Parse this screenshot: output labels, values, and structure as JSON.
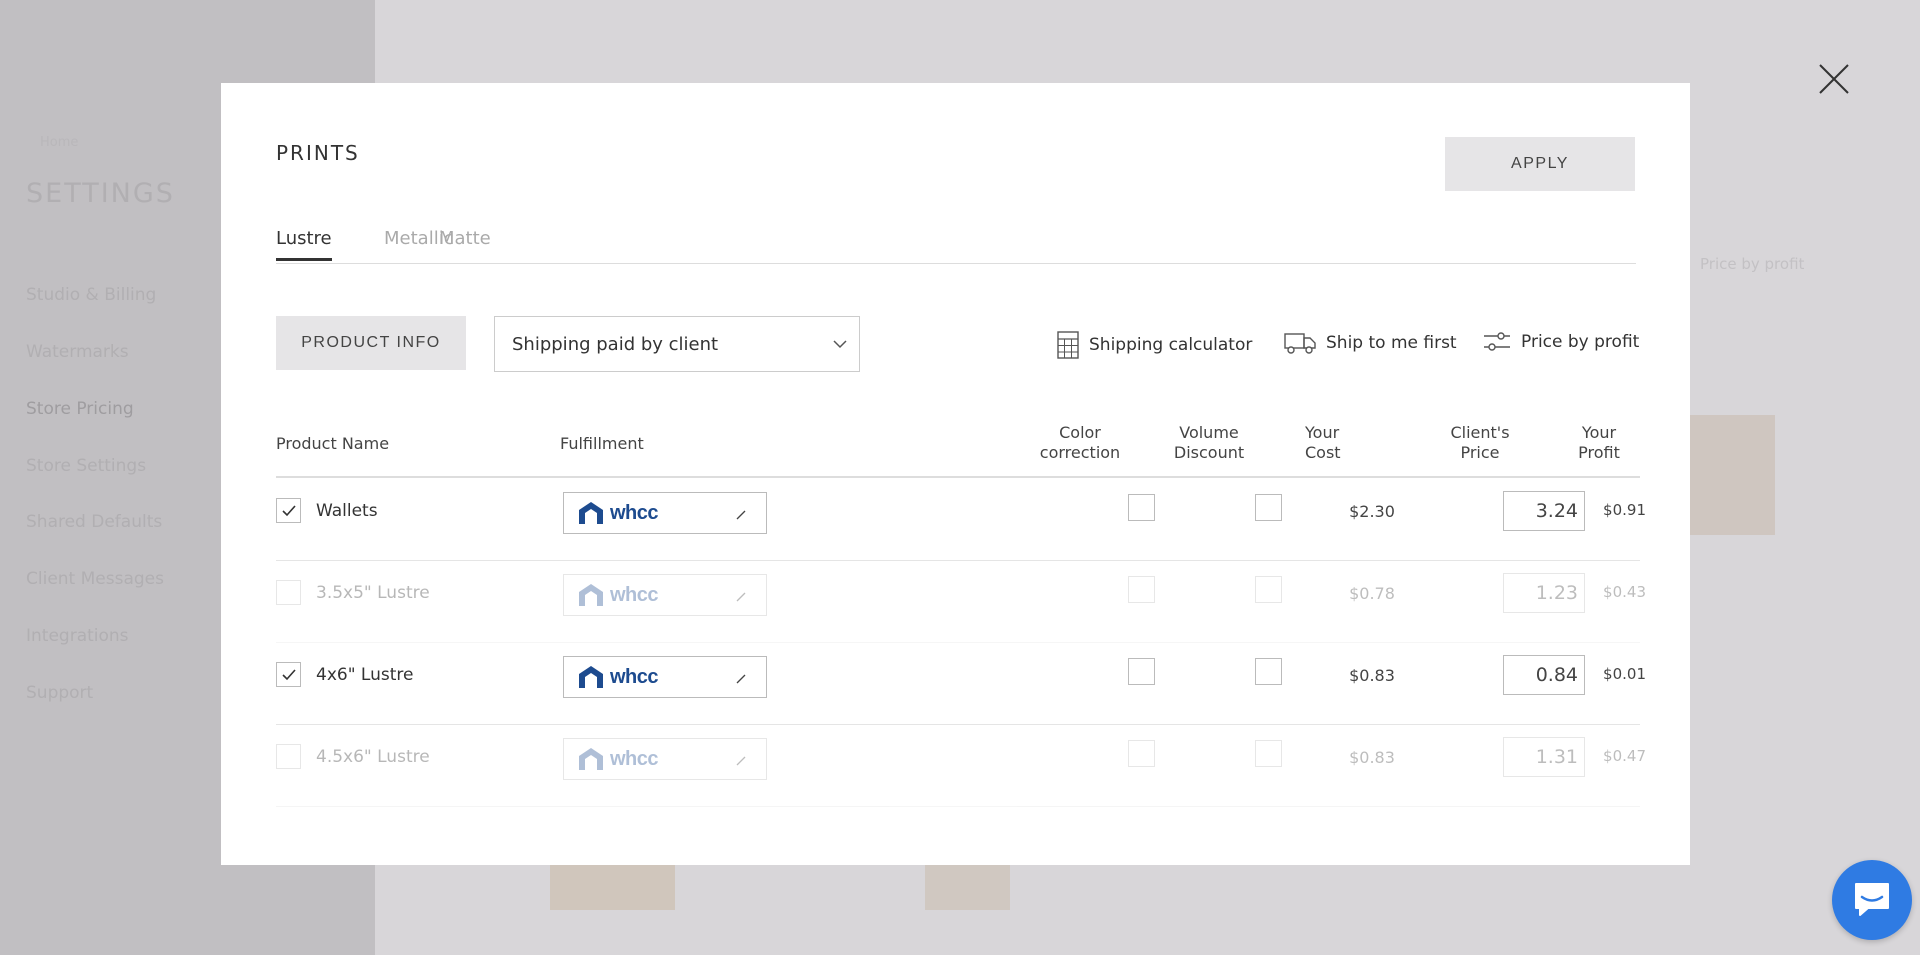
{
  "background": {
    "home": "Home",
    "settings_title": "SETTINGS",
    "nav": [
      "Studio & Billing",
      "Watermarks",
      "Store Pricing",
      "Store Settings",
      "Shared Defaults",
      "Client Messages",
      "Integrations",
      "Support"
    ],
    "active_nav": "Store Pricing",
    "price_by_profit": "Price by profit"
  },
  "modal": {
    "title": "PRINTS",
    "apply_label": "APPLY",
    "tabs": [
      {
        "label": "Lustre",
        "active": true
      },
      {
        "label": "Metallic",
        "active": false
      },
      {
        "label": "Matte",
        "active": false
      }
    ],
    "product_info_label": "PRODUCT INFO",
    "shipping_select": {
      "value": "Shipping paid by client"
    },
    "tools": {
      "shipping_calculator": "Shipping calculator",
      "ship_to_me_first": "Ship to me first",
      "price_by_profit": "Price by profit"
    },
    "table": {
      "headers": {
        "product_name": "Product Name",
        "fulfillment": "Fulfillment",
        "color_correction": [
          "Color",
          "correction"
        ],
        "volume_discount": [
          "Volume",
          "Discount"
        ],
        "your_cost": [
          "Your",
          "Cost"
        ],
        "clients_price": [
          "Client's",
          "Price"
        ],
        "your_profit": [
          "Your",
          "Profit"
        ]
      },
      "rows": [
        {
          "name": "Wallets",
          "checked": true,
          "lab": "whcc",
          "cost": "$2.30",
          "price": "3.24",
          "profit": "$0.91"
        },
        {
          "name": "3.5x5\" Lustre",
          "checked": false,
          "lab": "whcc",
          "cost": "$0.78",
          "price": "1.23",
          "profit": "$0.43"
        },
        {
          "name": "4x6\" Lustre",
          "checked": true,
          "lab": "whcc",
          "cost": "$0.83",
          "price": "0.84",
          "profit": "$0.01"
        },
        {
          "name": "4.5x6\" Lustre",
          "checked": false,
          "lab": "whcc",
          "cost": "$0.83",
          "price": "1.31",
          "profit": "$0.47"
        }
      ]
    }
  },
  "colors": {
    "whcc_blue": "#1d4b8f",
    "chat_blue": "#2f7be3",
    "overlay": "#d6d4d7"
  }
}
